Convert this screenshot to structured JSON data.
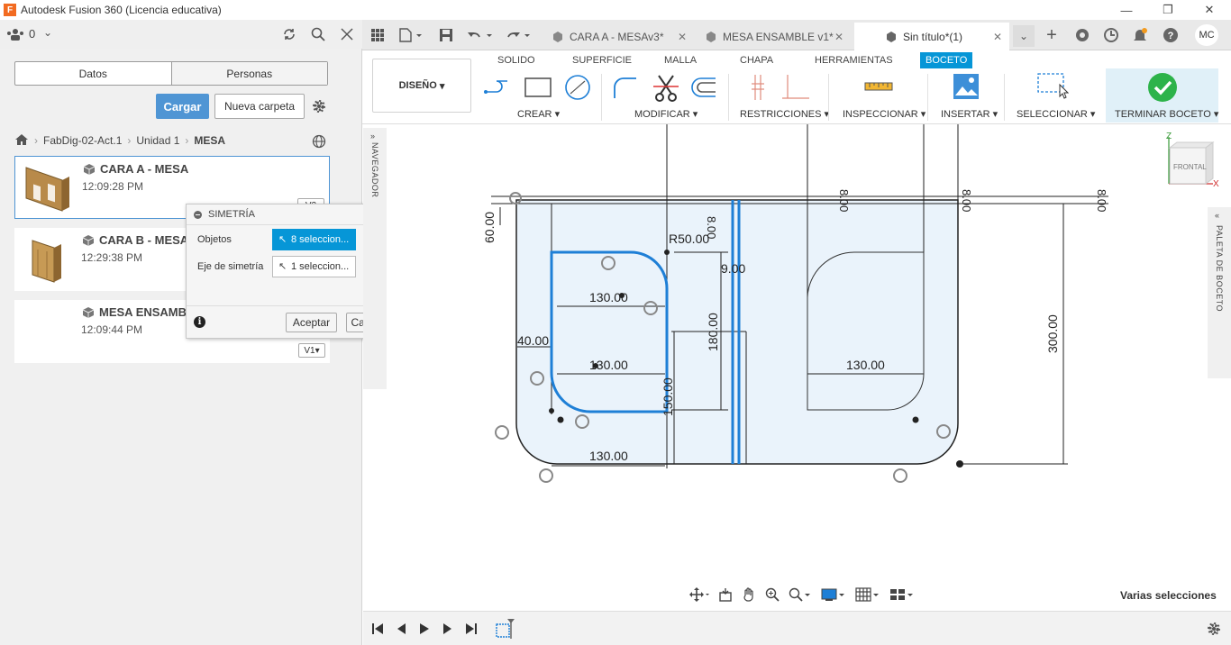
{
  "window": {
    "title": "Autodesk Fusion 360 (Licencia educativa)",
    "logo_letter": "F"
  },
  "left_panel": {
    "team_count": "0",
    "tabs": [
      "Datos",
      "Personas"
    ],
    "upload_label": "Cargar",
    "new_folder_label": "Nueva carpeta",
    "breadcrumb": [
      "FabDig-02-Act.1",
      "Unidad 1",
      "MESA"
    ],
    "files": [
      {
        "name": "CARA A - MESA",
        "time": "12:09:28 PM",
        "version": "V2"
      },
      {
        "name": "CARA B - MESA",
        "time": "12:29:38 PM",
        "version": ""
      },
      {
        "name": "MESA ENSAMBLE",
        "time": "12:09:44 PM",
        "version": "V1"
      }
    ]
  },
  "dialog": {
    "title": "SIMETRÍA",
    "objects_label": "Objetos",
    "objects_value": "8 seleccion...",
    "axis_label": "Eje de simetría",
    "axis_value": "1 seleccion...",
    "ok_label": "Aceptar",
    "cancel_label": "Cancelar"
  },
  "document_tabs": [
    {
      "label": "CARA A - MESAv3*",
      "active": false
    },
    {
      "label": "MESA ENSAMBLE v1*",
      "active": false
    },
    {
      "label": "Sin título*(1)",
      "active": true
    }
  ],
  "user_initials": "MC",
  "ribbon": {
    "workspace": "DISEÑO",
    "tabs": [
      "SOLIDO",
      "SUPERFICIE",
      "MALLA",
      "CHAPA",
      "HERRAMIENTAS",
      "BOCETO"
    ],
    "active_tab": "BOCETO",
    "groups": [
      "CREAR",
      "MODIFICAR",
      "RESTRICCIONES",
      "INSPECCIONAR",
      "INSERTAR",
      "SELECCIONAR",
      "TERMINAR BOCETO"
    ]
  },
  "navigator_label": "NAVEGADOR",
  "palette_label": "PALETA DE BOCETO",
  "viewcube": {
    "face": "FRONTAL",
    "axis_z": "Z",
    "axis_x": "X"
  },
  "dimensions": [
    "R50.00",
    "9.00",
    "60.00",
    "130.00",
    "130.00",
    "130.00",
    "130.00",
    "40.00",
    "180.00",
    "150.00",
    "300.00",
    "8.00",
    "8.00",
    "8.00",
    "8.00"
  ],
  "status_text": "Varias selecciones",
  "colors": {
    "accent": "#0696d7",
    "sketch_blue": "#1e7fd6",
    "finish_green": "#2db34a"
  }
}
